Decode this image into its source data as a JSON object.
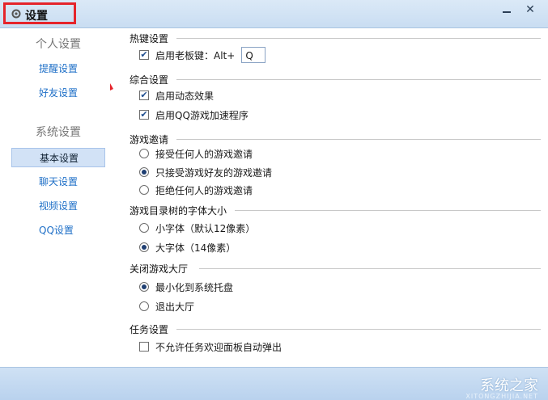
{
  "window": {
    "title": "设置",
    "minimize_icon": "minimize-icon",
    "close_icon": "close-icon"
  },
  "sidebar": {
    "personal_header": "个人设置",
    "personal_items": [
      {
        "label": "提醒设置"
      },
      {
        "label": "好友设置"
      }
    ],
    "system_header": "系统设置",
    "system_items": [
      {
        "label": "基本设置",
        "active": true
      },
      {
        "label": "聊天设置"
      },
      {
        "label": "视频设置"
      },
      {
        "label": "QQ设置"
      }
    ]
  },
  "sections": {
    "hotkey": {
      "title": "热键设置",
      "enable_label": "启用老板键：Alt+",
      "enable_checked": true,
      "key_value": "Q"
    },
    "general": {
      "title": "综合设置",
      "dynamic_label": "启用动态效果",
      "dynamic_checked": true,
      "accel_label": "启用QQ游戏加速程序",
      "accel_checked": true
    },
    "invite": {
      "title": "游戏邀请",
      "options": [
        {
          "label": "接受任何人的游戏邀请",
          "selected": false
        },
        {
          "label": "只接受游戏好友的游戏邀请",
          "selected": true
        },
        {
          "label": "拒绝任何人的游戏邀请",
          "selected": false
        }
      ]
    },
    "font": {
      "title": "游戏目录树的字体大小",
      "options": [
        {
          "label": "小字体（默认12像素）",
          "selected": false
        },
        {
          "label": "大字体（14像素）",
          "selected": true
        }
      ]
    },
    "close_hall": {
      "title": "关闭游戏大厅",
      "options": [
        {
          "label": "最小化到系统托盘",
          "selected": true
        },
        {
          "label": "退出大厅",
          "selected": false
        }
      ]
    },
    "task": {
      "title": "任务设置",
      "popup_label": "不允许任务欢迎面板自动弹出",
      "popup_checked": false
    }
  },
  "watermark": {
    "text": "系统之家",
    "sub": "XITONGZHIJIA.NET"
  }
}
